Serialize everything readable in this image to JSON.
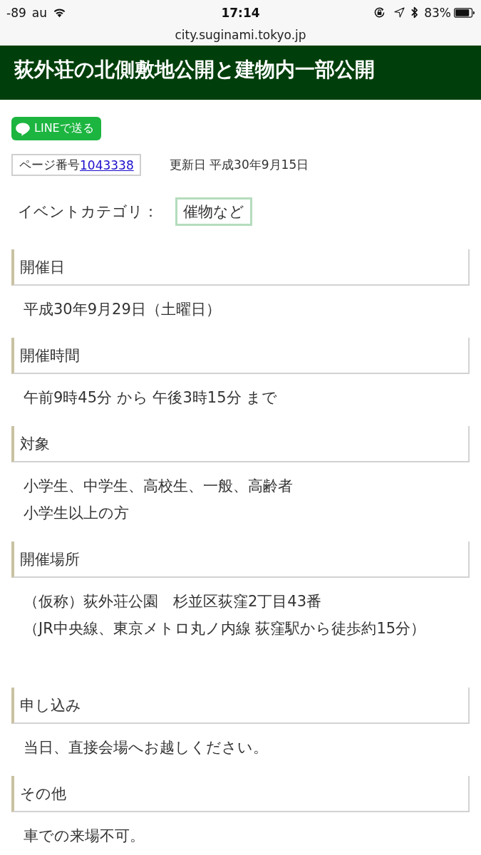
{
  "status_bar": {
    "signal": "-89",
    "carrier": "au",
    "time": "17:14",
    "battery": "83%"
  },
  "address_bar": {
    "url": "city.suginami.tokyo.jp"
  },
  "page_header": {
    "title": "荻外荘の北側敷地公開と建物内一部公開"
  },
  "share_button": {
    "label": "LINEで送る"
  },
  "page_info": {
    "page_number_label": "ページ番号",
    "page_number": "1043338",
    "updated": "更新日 平成30年9月15日"
  },
  "event_category": {
    "label": "イベントカテゴリ：",
    "value": "催物など"
  },
  "sections": [
    {
      "heading": "開催日",
      "lines": [
        "平成30年9月29日（土曜日）"
      ]
    },
    {
      "heading": "開催時間",
      "lines": [
        "午前9時45分 から 午後3時15分 まで"
      ]
    },
    {
      "heading": "対象",
      "lines": [
        "小学生、中学生、高校生、一般、高齢者",
        "小学生以上の方"
      ]
    },
    {
      "heading": "開催場所",
      "lines": [
        "（仮称）荻外荘公園　杉並区荻窪2丁目43番",
        "（JR中央線、東京メトロ丸ノ内線 荻窪駅から徒歩約15分）"
      ]
    },
    {
      "heading": "申し込み",
      "lines": [
        "当日、直接会場へお越しください。"
      ]
    },
    {
      "heading": "その他",
      "lines": [
        "車での来場不可。"
      ]
    }
  ]
}
